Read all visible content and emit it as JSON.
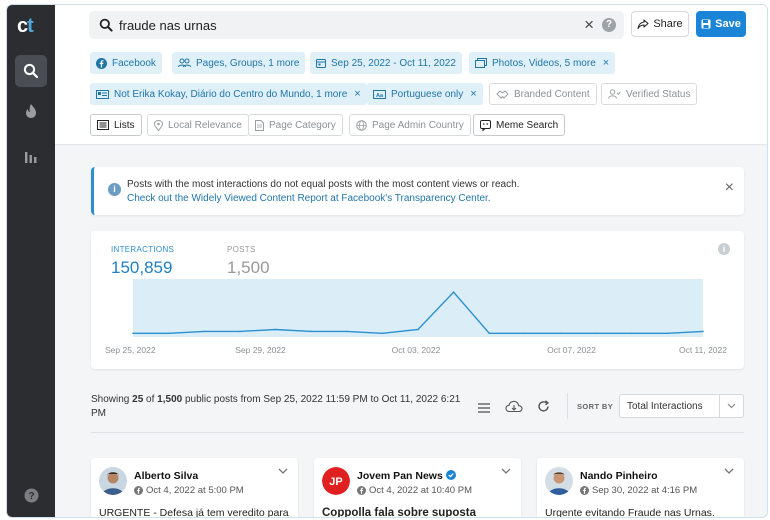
{
  "sidebar": {
    "logo_c": "c",
    "logo_t": "t",
    "items": [
      {
        "icon": "search-icon"
      },
      {
        "icon": "flame-icon"
      },
      {
        "icon": "bar-chart-icon"
      },
      {
        "icon": "help-icon"
      }
    ]
  },
  "search": {
    "query": "fraude nas urnas",
    "clear": "×",
    "help": "?"
  },
  "header": {
    "share_label": "Share",
    "save_label": "Save"
  },
  "filters": {
    "row1": [
      "Facebook",
      "Pages, Groups, 1 more",
      "Sep 25, 2022 - Oct 11, 2022",
      "Photos, Videos, 5 more"
    ],
    "row2": [
      "Not Erika Kokay, Diário do Centro do Mundo, 1 more",
      "Portuguese only",
      "Branded Content",
      "Verified Status"
    ],
    "row3": [
      "Lists",
      "Local Relevance",
      "Page Category",
      "Page Admin Country",
      "Meme Search"
    ],
    "remove": "×"
  },
  "banner": {
    "line1": "Posts with the most interactions do not equal posts with the most content views or reach.",
    "line2": "Check out the Widely Viewed Content Report at Facebook's Transparency Center.",
    "close": "×"
  },
  "metrics": {
    "interactions_label": "INTERACTIONS",
    "interactions_value": "150,859",
    "posts_label": "POSTS",
    "posts_value": "1,500",
    "info": "i"
  },
  "chart_data": {
    "type": "line",
    "x_tick_labels": [
      "Sep 25, 2022",
      "Sep 29, 2022",
      "Oct 03, 2022",
      "Oct 07, 2022",
      "Oct 11, 2022"
    ],
    "x": [
      "Sep 25",
      "Sep 26",
      "Sep 27",
      "Sep 28",
      "Sep 29",
      "Sep 30",
      "Oct 1",
      "Oct 2",
      "Oct 3",
      "Oct 4",
      "Oct 5",
      "Oct 6",
      "Oct 7",
      "Oct 8",
      "Oct 9",
      "Oct 10",
      "Oct 11"
    ],
    "values": [
      2,
      2,
      3,
      3,
      4,
      3,
      3,
      2,
      4,
      24,
      2,
      2,
      2,
      2,
      2,
      2,
      3
    ],
    "ylim": [
      0,
      30
    ],
    "grid": false,
    "colors": {
      "line": "#2b8fd0",
      "area": "#dbeef8"
    }
  },
  "results": {
    "prefix": "Showing ",
    "shown": "25",
    "of": " of ",
    "total": "1,500",
    "suffix": " public posts from Sep 25, 2022 11:59 PM to Oct 11, 2022 6:21 PM",
    "sort_by": "SORT BY",
    "sort_value": "Total Interactions"
  },
  "posts": [
    {
      "name": "Alberto Silva",
      "date": "Oct 4, 2022 at 5:00 PM",
      "body": "URGENTE - Defesa já tem veredito para"
    },
    {
      "name": "Jovem Pan News",
      "date": "Oct 4, 2022 at 10:40 PM",
      "body": "Coppolla fala sobre suposta"
    },
    {
      "name": "Nando Pinheiro",
      "date": "Sep 30, 2022 at 4:16 PM",
      "body": "Urgente evitando Fraude nas Urnas."
    }
  ],
  "colors": {
    "accent": "#1a84d6",
    "sidebar": "#2b2d31",
    "chip_bg": "#dff0f8"
  }
}
